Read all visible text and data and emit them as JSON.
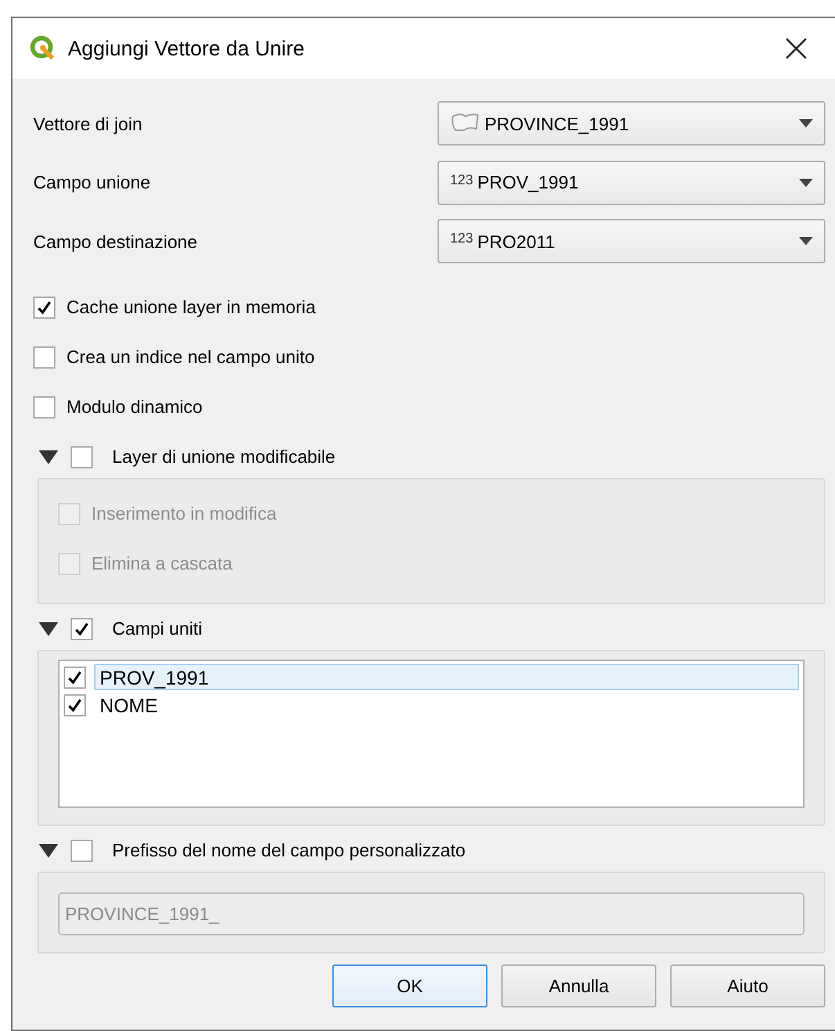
{
  "window": {
    "title": "Aggiungi Vettore da Unire"
  },
  "fields": [
    {
      "label": "Vettore di join",
      "value": "PROVINCE_1991",
      "kind": "layer"
    },
    {
      "label": "Campo unione",
      "value": "PROV_1991",
      "kind": "number",
      "badge": "123"
    },
    {
      "label": "Campo destinazione",
      "value": "PRO2011",
      "kind": "number",
      "badge": "123"
    }
  ],
  "options": [
    {
      "label": "Cache unione layer in memoria",
      "checked": true
    },
    {
      "label": "Crea un indice nel campo unito",
      "checked": false
    },
    {
      "label": "Modulo dinamico",
      "checked": false
    }
  ],
  "groups": [
    {
      "label": "Layer di unione modificabile",
      "checked": false,
      "expanded": true,
      "kind": "options",
      "items": [
        {
          "label": "Inserimento in modifica",
          "checked": false,
          "disabled": true
        },
        {
          "label": "Elimina a cascata",
          "checked": false,
          "disabled": true
        }
      ]
    },
    {
      "label": "Campi uniti",
      "checked": true,
      "expanded": true,
      "kind": "list",
      "items": [
        {
          "label": "PROV_1991",
          "checked": true,
          "selected": true
        },
        {
          "label": "NOME",
          "checked": true,
          "selected": false
        }
      ]
    },
    {
      "label": "Prefisso del nome del campo personalizzato",
      "checked": false,
      "expanded": true,
      "kind": "field",
      "value": "PROVINCE_1991_",
      "disabled": true
    }
  ],
  "buttons": [
    {
      "label": "OK",
      "default": true
    },
    {
      "label": "Annulla",
      "default": false
    },
    {
      "label": "Aiuto",
      "default": false
    }
  ]
}
